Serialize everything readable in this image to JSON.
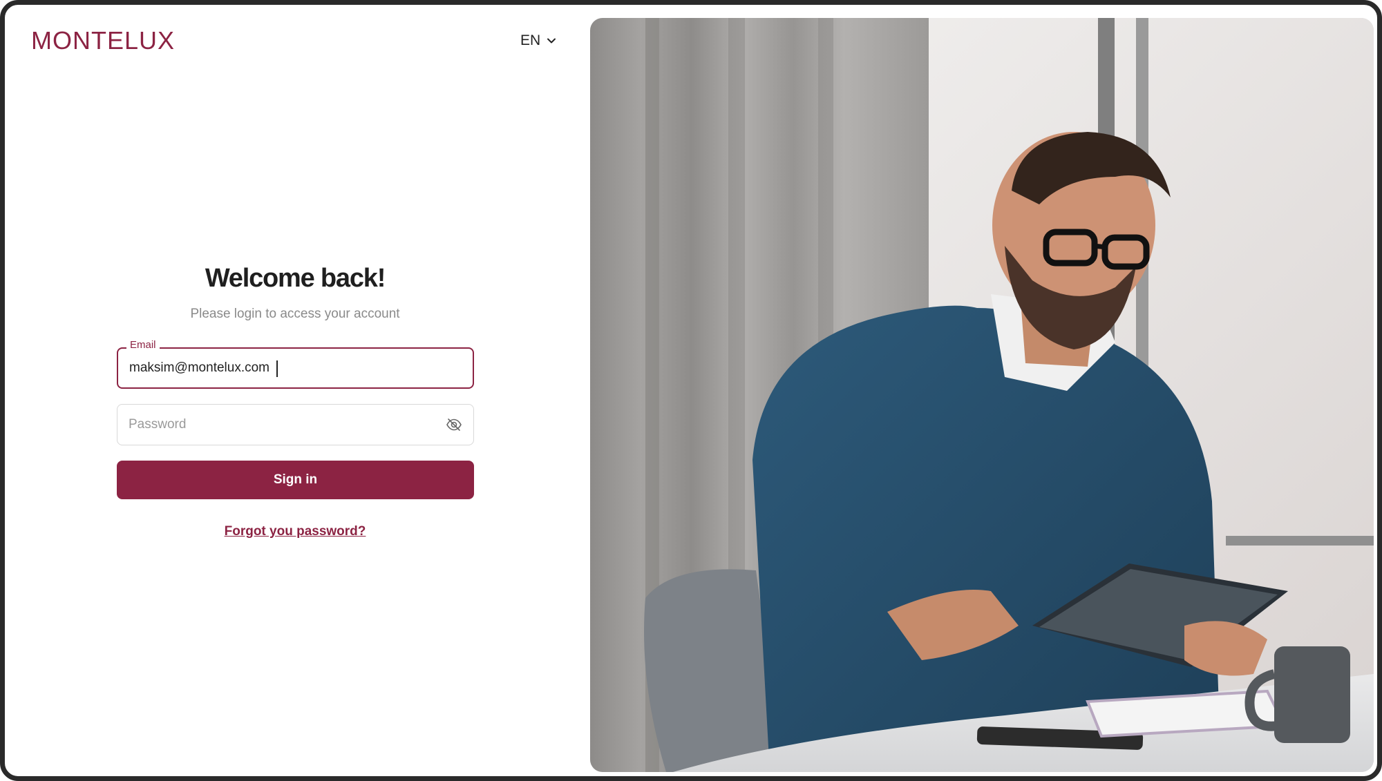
{
  "brand": {
    "name": "MONTELUX",
    "color": "#8c2343"
  },
  "language": {
    "selected": "EN",
    "icon": "chevron-down-icon"
  },
  "login": {
    "title": "Welcome back!",
    "subtitle": "Please login to access your account",
    "email": {
      "label": "Email",
      "value": "maksim@montelux.com"
    },
    "password": {
      "placeholder": "Password",
      "toggle_icon": "eye-off-icon"
    },
    "submit_label": "Sign in",
    "forgot_label": "Forgot you password?"
  },
  "hero": {
    "icon": "hero-photo"
  }
}
